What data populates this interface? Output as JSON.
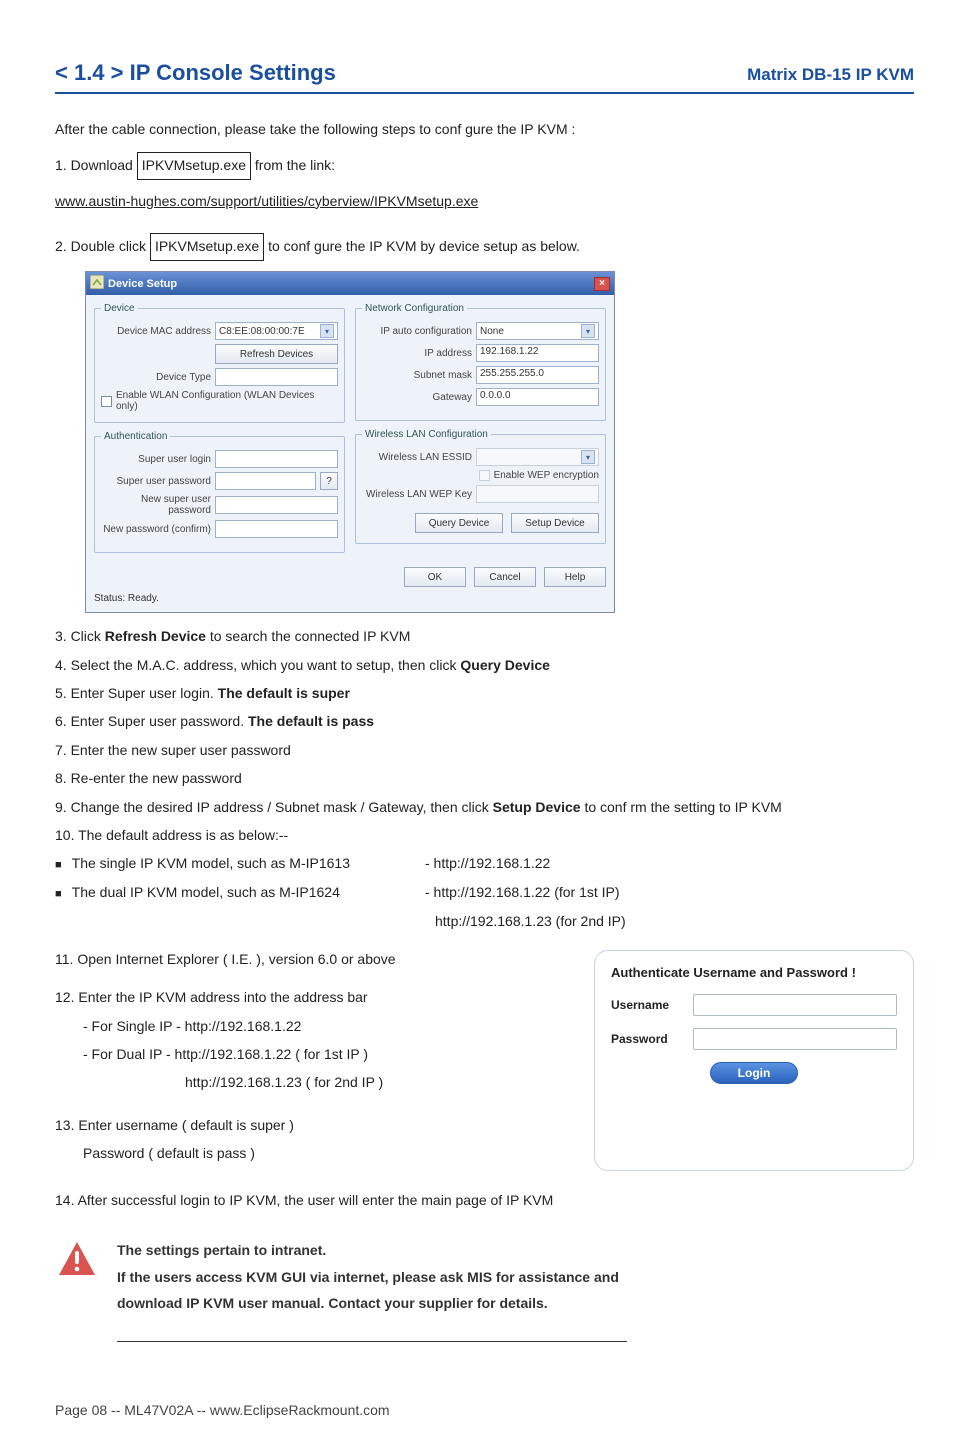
{
  "header": {
    "section_title": "< 1.4 > IP Console Settings",
    "product": "Matrix  DB-15 IP KVM"
  },
  "intro": {
    "line1": "After the cable connection, please take the following steps to conf gure the IP KVM :",
    "step1_pre": "1.  Download  ",
    "exe": "IPKVMsetup.exe",
    "step1_post": " from the link:",
    "link": "www.austin-hughes.com/support/utilities/cyberview/IPKVMsetup.exe",
    "step2_pre": "2.  Double click ",
    "step2_post": "  to conf gure the IP KVM by device setup as below."
  },
  "devicesetup": {
    "title": "Device Setup",
    "grp_device": "Device",
    "lbl_mac": "Device MAC address",
    "val_mac": "C8:EE:08:00:00:7E",
    "btn_refresh": "Refresh Devices",
    "lbl_type": "Device Type",
    "chk_wlan": "Enable WLAN Configuration (WLAN Devices only)",
    "grp_auth": "Authentication",
    "lbl_login": "Super user login",
    "lbl_pwd": "Super user password",
    "btn_q": "?",
    "lbl_newpwd": "New super user password",
    "lbl_confirm": "New password (confirm)",
    "grp_net": "Network Configuration",
    "lbl_ipauto": "IP auto configuration",
    "val_ipauto": "None",
    "lbl_ipaddr": "IP address",
    "val_ipaddr": "192.168.1.22",
    "lbl_subnet": "Subnet mask",
    "val_subnet": "255.255.255.0",
    "lbl_gateway": "Gateway",
    "val_gateway": "0.0.0.0",
    "grp_wlan": "Wireless LAN Configuration",
    "lbl_essid": "Wireless LAN ESSID",
    "chk_wep": "Enable WEP encryption",
    "lbl_wepkey": "Wireless LAN WEP Key",
    "btn_query": "Query Device",
    "btn_setup": "Setup Device",
    "btn_ok": "OK",
    "btn_cancel": "Cancel",
    "btn_help": "Help",
    "status": "Status: Ready."
  },
  "steps": {
    "s3a": "3.  Click ",
    "s3b": "Refresh Device ",
    "s3c": "to search the connected IP KVM",
    "s4a": "4.  Select the M.A.C. address, which you want to setup, then click ",
    "s4b": "Query Device",
    "s5a": "5.  Enter Super user login.  ",
    "s5b": "The default is super",
    "s6a": "6.  Enter Super user password.  ",
    "s6b": "The default is pass",
    "s7": "7.  Enter the new super user password",
    "s8": "8.  Re-enter the new password",
    "s9a": "9.  Change the desired IP address / Subnet mask / Gateway, then click ",
    "s9b": "Setup Device ",
    "s9c": "to conf rm the setting to IP KVM",
    "s10": "10. The default address is as below:--",
    "b1a": "The single IP KVM model, such as M-IP1613",
    "b1b": "- http://192.168.1.22",
    "b2a": "The dual IP KVM model,    such as M-IP1624",
    "b2b": "- http://192.168.1.22 (for 1st IP)",
    "b2c": "http://192.168.1.23 (for 2nd IP)",
    "s11": "11. Open Internet Explorer ( I.E. ), version 6.0 or above",
    "s12": "12. Enter the IP KVM address into the address bar",
    "s12a": "- For Single IP - http://192.168.1.22",
    "s12b": "- For Dual IP    - http://192.168.1.22 ( for 1st IP )",
    "s12c": "http://192.168.1.23 ( for 2nd IP )",
    "s13": "13. Enter username ( default is super )",
    "s13b": "Password ( default is pass )",
    "s14": "14. After successful login to IP KVM, the user will enter the main page of IP KVM"
  },
  "auth_panel": {
    "title": "Authenticate Username and Password !",
    "username": "Username",
    "password": "Password",
    "login": "Login"
  },
  "note": {
    "l1": "The settings pertain to intranet.",
    "l2": "If the users access KVM GUI via internet, please ask MIS for assistance and",
    "l3": "download IP KVM user manual. Contact your supplier for details."
  },
  "footer": "Page 08 -- ML47V02A -- www.EclipseRackmount.com"
}
